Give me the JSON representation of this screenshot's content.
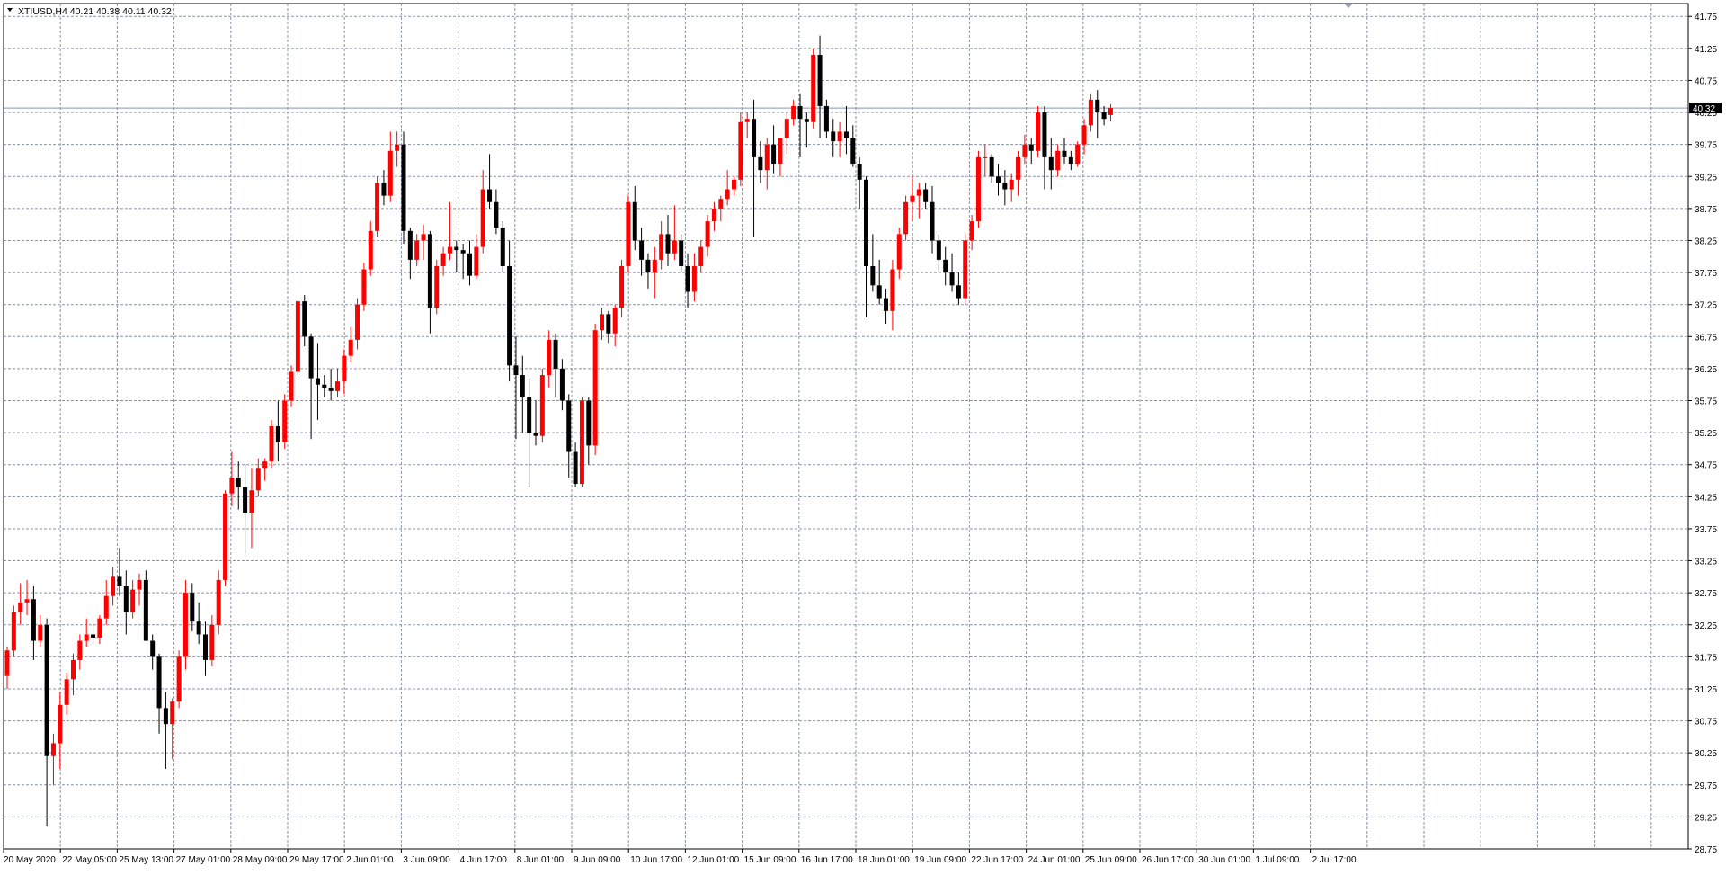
{
  "header": {
    "title": "XTIUSD,H4  40.21 40.38 40.11 40.32"
  },
  "chart_data": {
    "type": "candlestick",
    "symbol": "XTIUSD",
    "timeframe": "H4",
    "current_price": "40.32",
    "ylim": [
      28.75,
      41.95
    ],
    "grid": true,
    "colors": {
      "background": "#ffffff",
      "bull": "#ff0000",
      "bear": "#000000",
      "grid": "#8a93a8",
      "price_line": "#8796b0",
      "axis": "#000000"
    },
    "y_ticks": [
      "41.75",
      "41.25",
      "40.75",
      "40.25",
      "39.75",
      "39.25",
      "38.75",
      "38.25",
      "37.75",
      "37.25",
      "36.75",
      "36.25",
      "35.75",
      "35.25",
      "34.75",
      "34.25",
      "33.75",
      "33.25",
      "32.75",
      "32.25",
      "31.75",
      "31.25",
      "30.75",
      "30.25",
      "29.75",
      "29.25",
      "28.75"
    ],
    "x_labels": [
      "20 May 2020",
      "22 May 05:00",
      "25 May 13:00",
      "27 May 01:00",
      "28 May 09:00",
      "29 May 17:00",
      "2 Jun 01:00",
      "3 Jun 09:00",
      "4 Jun 17:00",
      "8 Jun 01:00",
      "9 Jun 09:00",
      "10 Jun 17:00",
      "12 Jun 01:00",
      "15 Jun 09:00",
      "16 Jun 17:00",
      "18 Jun 01:00",
      "19 Jun 09:00",
      "22 Jun 17:00",
      "24 Jun 01:00",
      "25 Jun 09:00",
      "26 Jun 17:00",
      "30 Jun 01:00",
      "1 Jul 09:00",
      "2 Jul 17:00"
    ],
    "ohlc": [
      [
        31.45,
        31.9,
        31.25,
        31.85
      ],
      [
        31.85,
        32.55,
        31.75,
        32.45
      ],
      [
        32.45,
        32.9,
        32.25,
        32.6
      ],
      [
        32.6,
        32.95,
        32.4,
        32.65
      ],
      [
        32.65,
        32.85,
        31.7,
        32.0
      ],
      [
        32.0,
        32.4,
        31.9,
        32.25
      ],
      [
        32.25,
        32.35,
        29.1,
        30.2
      ],
      [
        30.2,
        30.55,
        29.75,
        30.4
      ],
      [
        30.4,
        31.2,
        30.0,
        31.0
      ],
      [
        31.0,
        31.5,
        30.85,
        31.4
      ],
      [
        31.4,
        31.8,
        31.15,
        31.7
      ],
      [
        31.7,
        32.1,
        31.55,
        32.0
      ],
      [
        32.0,
        32.35,
        31.9,
        32.1
      ],
      [
        32.1,
        32.3,
        31.95,
        32.05
      ],
      [
        32.05,
        32.4,
        31.95,
        32.35
      ],
      [
        32.35,
        32.95,
        32.25,
        32.7
      ],
      [
        32.7,
        33.15,
        32.55,
        33.0
      ],
      [
        33.0,
        33.45,
        32.7,
        32.85
      ],
      [
        32.85,
        33.1,
        32.1,
        32.45
      ],
      [
        32.45,
        32.95,
        32.35,
        32.8
      ],
      [
        32.8,
        33.05,
        32.55,
        32.95
      ],
      [
        32.95,
        33.1,
        32.5,
        32.0
      ],
      [
        32.0,
        32.1,
        31.55,
        31.75
      ],
      [
        31.75,
        31.8,
        30.55,
        30.95
      ],
      [
        30.95,
        31.2,
        30.0,
        30.7
      ],
      [
        30.7,
        31.1,
        30.15,
        31.05
      ],
      [
        31.05,
        31.85,
        30.95,
        31.75
      ],
      [
        31.75,
        32.95,
        31.55,
        32.75
      ],
      [
        32.75,
        32.9,
        32.15,
        32.3
      ],
      [
        32.3,
        32.6,
        31.95,
        32.1
      ],
      [
        32.1,
        32.3,
        31.45,
        31.7
      ],
      [
        31.7,
        32.4,
        31.6,
        32.25
      ],
      [
        32.25,
        33.1,
        32.1,
        32.95
      ],
      [
        32.95,
        34.35,
        32.85,
        34.3
      ],
      [
        34.3,
        34.95,
        34.1,
        34.55
      ],
      [
        34.55,
        34.8,
        34.05,
        34.4
      ],
      [
        34.4,
        34.75,
        33.35,
        34.0
      ],
      [
        34.0,
        34.7,
        33.45,
        34.35
      ],
      [
        34.35,
        34.85,
        34.25,
        34.7
      ],
      [
        34.7,
        34.85,
        34.5,
        34.8
      ],
      [
        34.8,
        35.45,
        34.7,
        35.35
      ],
      [
        35.35,
        35.75,
        34.8,
        35.1
      ],
      [
        35.1,
        35.85,
        35.0,
        35.75
      ],
      [
        35.75,
        36.3,
        35.65,
        36.2
      ],
      [
        36.2,
        37.35,
        36.15,
        37.3
      ],
      [
        37.3,
        37.4,
        36.6,
        36.75
      ],
      [
        36.75,
        36.8,
        35.15,
        36.1
      ],
      [
        36.1,
        36.65,
        35.45,
        36.0
      ],
      [
        36.0,
        36.15,
        35.8,
        35.95
      ],
      [
        35.95,
        36.25,
        35.75,
        35.9
      ],
      [
        35.9,
        36.25,
        35.8,
        36.05
      ],
      [
        36.05,
        36.55,
        35.85,
        36.45
      ],
      [
        36.45,
        36.9,
        36.35,
        36.7
      ],
      [
        36.7,
        37.35,
        36.55,
        37.25
      ],
      [
        37.25,
        37.9,
        37.15,
        37.8
      ],
      [
        37.8,
        38.55,
        37.7,
        38.4
      ],
      [
        38.4,
        39.25,
        38.3,
        39.15
      ],
      [
        39.15,
        39.35,
        38.8,
        38.95
      ],
      [
        38.95,
        39.95,
        38.85,
        39.65
      ],
      [
        39.65,
        39.95,
        39.4,
        39.75
      ],
      [
        39.75,
        39.95,
        38.2,
        38.4
      ],
      [
        38.4,
        38.45,
        37.65,
        37.95
      ],
      [
        37.95,
        38.35,
        37.85,
        38.25
      ],
      [
        38.25,
        38.5,
        37.95,
        38.35
      ],
      [
        38.35,
        38.4,
        36.8,
        37.2
      ],
      [
        37.2,
        37.95,
        37.1,
        37.85
      ],
      [
        37.85,
        38.15,
        37.7,
        38.05
      ],
      [
        38.05,
        38.85,
        37.95,
        38.15
      ],
      [
        38.15,
        38.25,
        37.75,
        38.1
      ],
      [
        38.1,
        38.2,
        37.65,
        38.05
      ],
      [
        38.05,
        38.25,
        37.55,
        37.7
      ],
      [
        37.7,
        38.35,
        37.65,
        38.15
      ],
      [
        38.15,
        39.35,
        38.05,
        39.05
      ],
      [
        39.05,
        39.6,
        38.75,
        38.85
      ],
      [
        38.85,
        39.05,
        38.35,
        38.45
      ],
      [
        38.45,
        38.55,
        37.75,
        37.85
      ],
      [
        37.85,
        38.25,
        36.05,
        36.3
      ],
      [
        36.3,
        36.75,
        35.15,
        36.15
      ],
      [
        36.15,
        36.45,
        35.25,
        35.8
      ],
      [
        35.8,
        36.1,
        34.4,
        35.25
      ],
      [
        35.25,
        35.75,
        35.05,
        35.2
      ],
      [
        35.2,
        36.25,
        35.1,
        36.15
      ],
      [
        36.15,
        36.85,
        35.95,
        36.7
      ],
      [
        36.7,
        36.8,
        35.8,
        36.25
      ],
      [
        36.25,
        36.4,
        35.6,
        35.75
      ],
      [
        35.75,
        35.85,
        34.55,
        34.95
      ],
      [
        34.95,
        35.1,
        34.4,
        34.45
      ],
      [
        34.45,
        35.8,
        34.4,
        35.75
      ],
      [
        35.75,
        35.8,
        34.75,
        35.05
      ],
      [
        35.05,
        36.95,
        34.9,
        36.85
      ],
      [
        36.85,
        37.2,
        36.7,
        37.1
      ],
      [
        37.1,
        37.15,
        36.65,
        36.8
      ],
      [
        36.8,
        37.25,
        36.6,
        37.2
      ],
      [
        37.2,
        37.95,
        37.05,
        37.85
      ],
      [
        37.85,
        38.95,
        37.75,
        38.85
      ],
      [
        38.85,
        39.1,
        38.1,
        38.25
      ],
      [
        38.25,
        38.45,
        37.7,
        37.95
      ],
      [
        37.95,
        38.05,
        37.5,
        37.75
      ],
      [
        37.75,
        38.15,
        37.35,
        37.95
      ],
      [
        37.95,
        38.55,
        37.8,
        38.35
      ],
      [
        38.35,
        38.65,
        37.85,
        38.05
      ],
      [
        38.05,
        38.8,
        37.95,
        38.25
      ],
      [
        38.25,
        38.35,
        37.75,
        37.85
      ],
      [
        37.85,
        38.05,
        37.2,
        37.45
      ],
      [
        37.45,
        38.05,
        37.3,
        37.85
      ],
      [
        37.85,
        38.25,
        37.75,
        38.15
      ],
      [
        38.15,
        38.65,
        38.0,
        38.55
      ],
      [
        38.55,
        38.85,
        38.4,
        38.75
      ],
      [
        38.75,
        38.95,
        38.55,
        38.9
      ],
      [
        38.9,
        39.35,
        38.8,
        39.05
      ],
      [
        39.05,
        39.25,
        38.95,
        39.2
      ],
      [
        39.2,
        40.25,
        39.1,
        40.1
      ],
      [
        40.1,
        40.25,
        39.85,
        40.15
      ],
      [
        40.15,
        40.45,
        38.3,
        39.55
      ],
      [
        39.55,
        39.8,
        39.15,
        39.35
      ],
      [
        39.35,
        39.85,
        39.05,
        39.75
      ],
      [
        39.75,
        40.05,
        39.3,
        39.45
      ],
      [
        39.45,
        39.85,
        39.25,
        39.85
      ],
      [
        39.85,
        40.25,
        39.6,
        40.15
      ],
      [
        40.15,
        40.45,
        40.05,
        40.35
      ],
      [
        40.35,
        40.55,
        39.55,
        40.15
      ],
      [
        40.15,
        40.25,
        39.7,
        40.1
      ],
      [
        40.1,
        41.25,
        40.0,
        41.15
      ],
      [
        41.15,
        41.45,
        39.85,
        40.35
      ],
      [
        40.35,
        40.45,
        39.85,
        39.95
      ],
      [
        39.95,
        40.15,
        39.55,
        39.8
      ],
      [
        39.8,
        40.1,
        39.55,
        39.95
      ],
      [
        39.95,
        40.35,
        39.6,
        39.85
      ],
      [
        39.85,
        40.05,
        39.4,
        39.45
      ],
      [
        39.45,
        39.55,
        38.75,
        39.2
      ],
      [
        39.2,
        39.25,
        37.05,
        37.85
      ],
      [
        37.85,
        38.35,
        37.45,
        37.55
      ],
      [
        37.55,
        37.95,
        37.25,
        37.35
      ],
      [
        37.35,
        37.5,
        36.95,
        37.15
      ],
      [
        37.15,
        37.95,
        36.85,
        37.8
      ],
      [
        37.8,
        38.45,
        37.65,
        38.35
      ],
      [
        38.35,
        38.95,
        38.25,
        38.85
      ],
      [
        38.85,
        39.25,
        38.55,
        38.95
      ],
      [
        38.95,
        39.15,
        38.6,
        39.05
      ],
      [
        39.05,
        39.15,
        38.75,
        38.85
      ],
      [
        38.85,
        39.1,
        38.05,
        38.25
      ],
      [
        38.25,
        38.35,
        37.75,
        37.95
      ],
      [
        37.95,
        38.15,
        37.55,
        37.75
      ],
      [
        37.75,
        38.05,
        37.45,
        37.55
      ],
      [
        37.55,
        37.75,
        37.25,
        37.35
      ],
      [
        37.35,
        38.35,
        37.25,
        38.25
      ],
      [
        38.25,
        38.65,
        38.1,
        38.55
      ],
      [
        38.55,
        39.65,
        38.45,
        39.55
      ],
      [
        39.55,
        39.75,
        39.25,
        39.55
      ],
      [
        39.55,
        39.6,
        39.15,
        39.25
      ],
      [
        39.25,
        39.45,
        38.95,
        39.15
      ],
      [
        39.15,
        39.35,
        38.8,
        39.05
      ],
      [
        39.05,
        39.3,
        38.85,
        39.2
      ],
      [
        39.2,
        39.65,
        38.95,
        39.55
      ],
      [
        39.55,
        39.9,
        39.45,
        39.75
      ],
      [
        39.75,
        39.85,
        39.45,
        39.65
      ],
      [
        39.65,
        40.35,
        39.55,
        40.25
      ],
      [
        40.25,
        40.35,
        39.05,
        39.55
      ],
      [
        39.55,
        39.85,
        39.05,
        39.35
      ],
      [
        39.35,
        39.75,
        39.25,
        39.65
      ],
      [
        39.65,
        39.85,
        39.45,
        39.55
      ],
      [
        39.55,
        39.65,
        39.35,
        39.45
      ],
      [
        39.45,
        39.8,
        39.4,
        39.75
      ],
      [
        39.75,
        40.15,
        39.6,
        40.05
      ],
      [
        40.05,
        40.55,
        39.95,
        40.45
      ],
      [
        40.45,
        40.6,
        39.85,
        40.25
      ],
      [
        40.25,
        40.35,
        40.05,
        40.15
      ],
      [
        40.21,
        40.38,
        40.11,
        40.32
      ]
    ]
  }
}
